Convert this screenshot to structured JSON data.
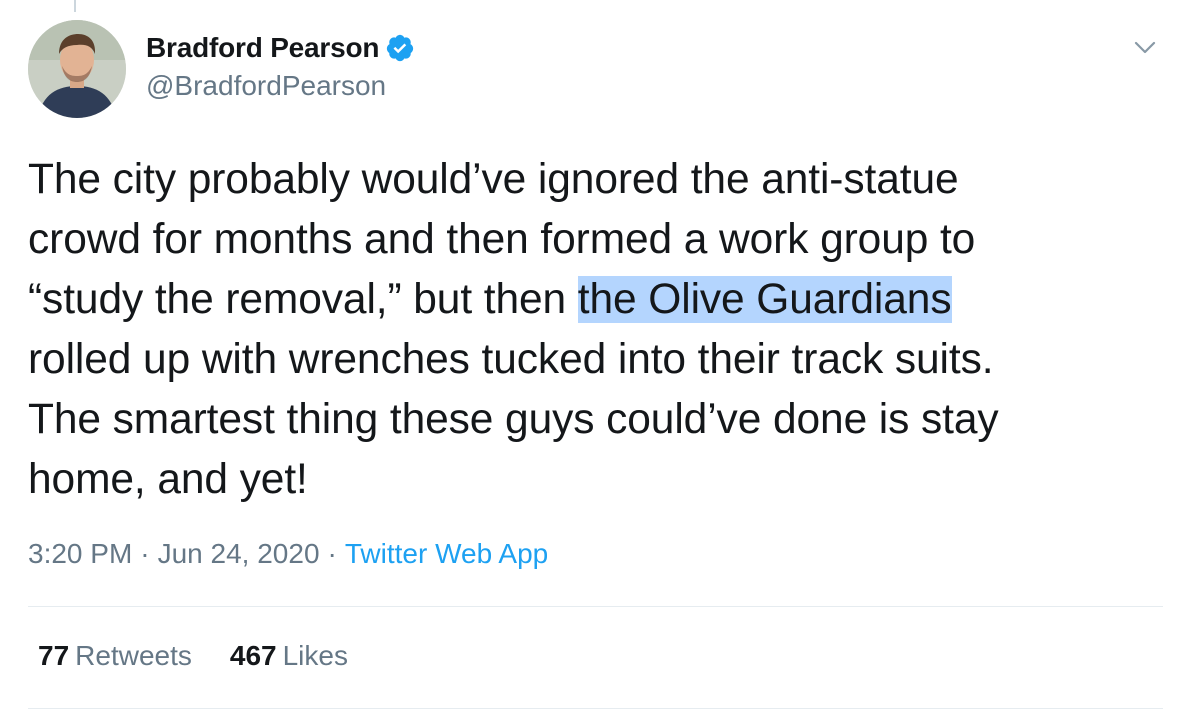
{
  "author": {
    "display_name": "Bradford Pearson",
    "handle": "@BradfordPearson",
    "verified": true
  },
  "tweet": {
    "lines": [
      [
        "The city probably would’ve ignored the anti-statue"
      ],
      [
        "crowd for months and then formed a work group to"
      ],
      [
        "“study the removal,” but then ",
        "the Olive Guardians"
      ],
      [
        "rolled up with wrenches tucked into their track suits."
      ],
      [
        "The smartest thing these guys could’ve done is stay"
      ],
      [
        "home, and yet!"
      ]
    ],
    "highlighted_text": "the Olive Guardians"
  },
  "meta": {
    "time": "3:20 PM",
    "separator": "·",
    "date": "Jun 24, 2020",
    "source": "Twitter Web App"
  },
  "stats": {
    "retweets_count": "77",
    "retweets_label": "Retweets",
    "likes_count": "467",
    "likes_label": "Likes"
  },
  "icons": {
    "verified": "verified-badge-icon",
    "more": "chevron-down-icon"
  },
  "colors": {
    "text": "#14171a",
    "secondary": "#657786",
    "accent": "#1da1f2",
    "highlight": "#b4d5fe",
    "divider": "#e6ecf0"
  }
}
